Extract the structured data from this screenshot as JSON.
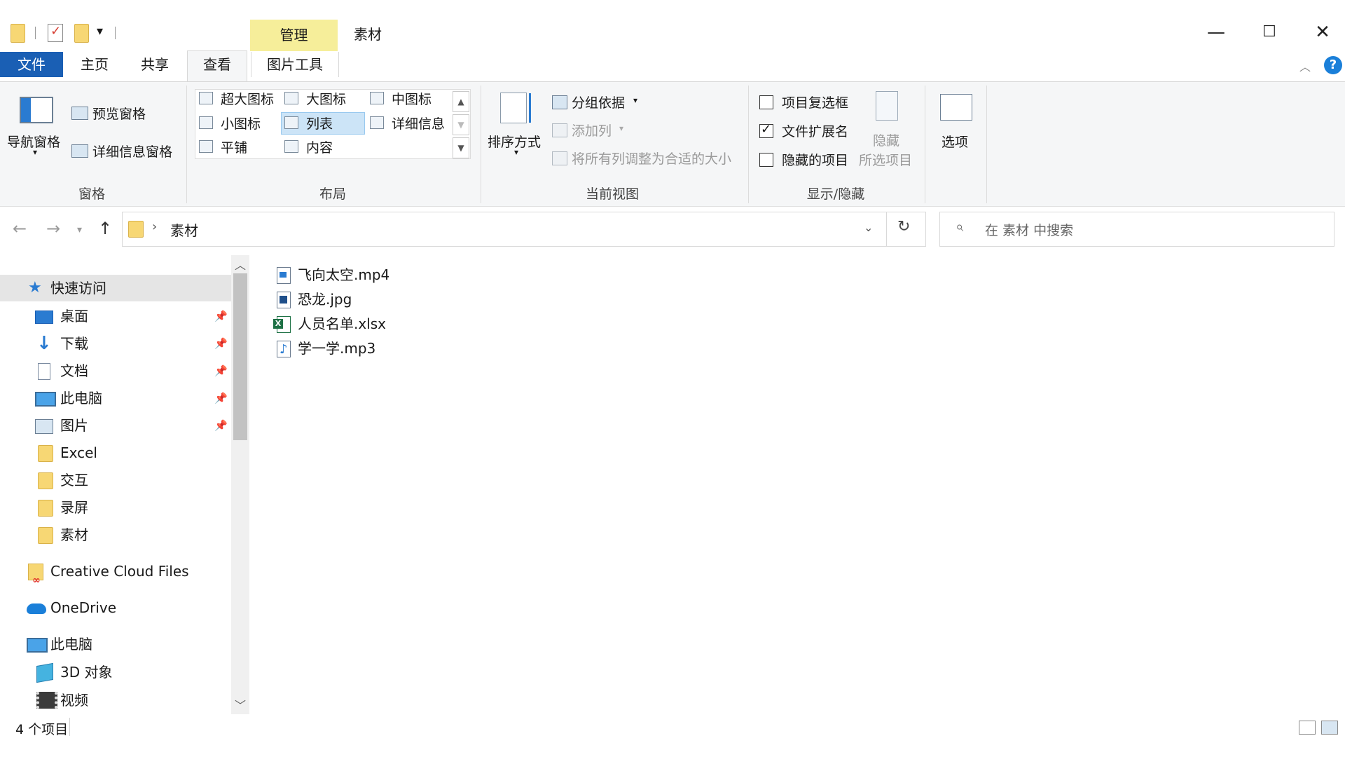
{
  "titlebar": {
    "contextual_tab": "管理",
    "window_title": "素材",
    "minimize": "—",
    "maximize": "☐",
    "close": "✕"
  },
  "ribbon_tabs": {
    "file": "文件",
    "home": "主页",
    "share": "共享",
    "view": "查看",
    "picture_tools": "图片工具"
  },
  "panes_group": {
    "nav_pane": "导航窗格",
    "preview_pane": "预览窗格",
    "details_pane": "详细信息窗格",
    "label": "窗格"
  },
  "layout_group": {
    "options": [
      "超大图标",
      "大图标",
      "中图标",
      "小图标",
      "列表",
      "详细信息",
      "平铺",
      "内容"
    ],
    "selected": "列表",
    "label": "布局"
  },
  "current_view_group": {
    "sort_by": "排序方式",
    "group_by": "分组依据",
    "add_columns": "添加列",
    "size_all_columns": "将所有列调整为合适的大小",
    "label": "当前视图"
  },
  "show_hide_group": {
    "item_checkboxes": {
      "label": "项目复选框",
      "checked": false
    },
    "file_extensions": {
      "label": "文件扩展名",
      "checked": true
    },
    "hidden_items": {
      "label": "隐藏的项目",
      "checked": false
    },
    "hide_selected": "隐藏",
    "hide_selected_line2": "所选项目",
    "label": "显示/隐藏"
  },
  "options_button": "选项",
  "address_bar": {
    "path": "素材",
    "separator": "›",
    "search_placeholder": "在 素材 中搜索"
  },
  "sidebar": {
    "quick_access": "快速访问",
    "items": [
      {
        "label": "桌面",
        "icon": "desktop-icon",
        "pinned": true
      },
      {
        "label": "下载",
        "icon": "download-icon",
        "pinned": true
      },
      {
        "label": "文档",
        "icon": "document-icon",
        "pinned": true
      },
      {
        "label": "此电脑",
        "icon": "pc-icon",
        "pinned": true
      },
      {
        "label": "图片",
        "icon": "pictures-icon",
        "pinned": true
      },
      {
        "label": "Excel",
        "icon": "folder-icon",
        "pinned": false
      },
      {
        "label": "交互",
        "icon": "folder-icon",
        "pinned": false
      },
      {
        "label": "录屏",
        "icon": "folder-icon",
        "pinned": false
      },
      {
        "label": "素材",
        "icon": "folder-icon",
        "pinned": false
      }
    ],
    "creative_cloud": "Creative Cloud Files",
    "onedrive": "OneDrive",
    "this_pc": "此电脑",
    "objects_3d": "3D 对象",
    "videos": "视频"
  },
  "files": [
    {
      "name": "飞向太空.mp4",
      "type": "video"
    },
    {
      "name": "恐龙.jpg",
      "type": "image"
    },
    {
      "name": "人员名单.xlsx",
      "type": "excel"
    },
    {
      "name": "学一学.mp3",
      "type": "audio"
    }
  ],
  "status_bar": {
    "item_count": "4 个项目"
  },
  "colors": {
    "file_tab": "#1a5fb4",
    "contextual_tab": "#f6ee9a",
    "selection": "#cce4f7",
    "help": "#1a7fd9"
  }
}
